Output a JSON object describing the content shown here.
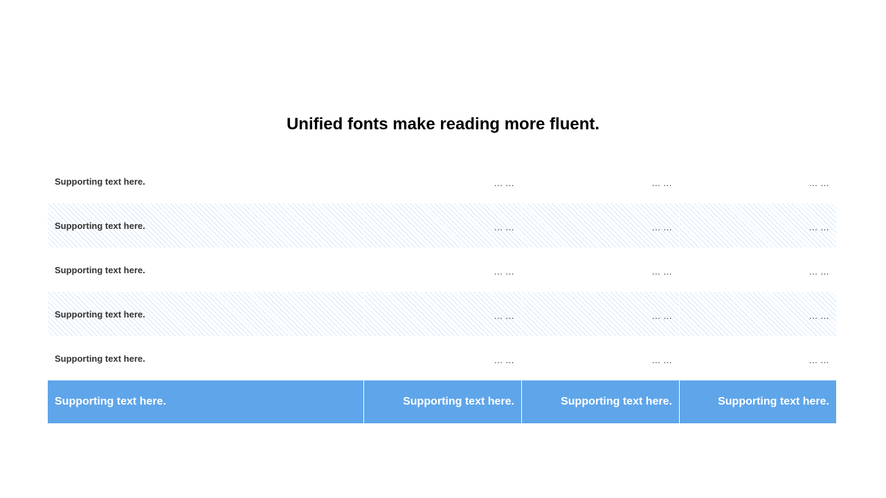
{
  "title": "Unified fonts make reading more fluent.",
  "table": {
    "rows": [
      {
        "label": "Supporting text here.",
        "values": [
          "… …",
          "… …",
          "… …"
        ],
        "striped": false
      },
      {
        "label": "Supporting text here.",
        "values": [
          "… …",
          "… …",
          "… …"
        ],
        "striped": true
      },
      {
        "label": "Supporting text here.",
        "values": [
          "… …",
          "… …",
          "… …"
        ],
        "striped": false
      },
      {
        "label": "Supporting text here.",
        "values": [
          "… …",
          "… …",
          "… …"
        ],
        "striped": true
      },
      {
        "label": "Supporting text here.",
        "values": [
          "… …",
          "… …",
          "… …"
        ],
        "striped": false
      }
    ],
    "total_row": [
      "Supporting text here.",
      "Supporting text here.",
      "Supporting text here.",
      "Supporting text here."
    ]
  },
  "colors": {
    "accent": "#5ea5ea",
    "stripe": "#d6e9fb",
    "text": "#333333"
  }
}
